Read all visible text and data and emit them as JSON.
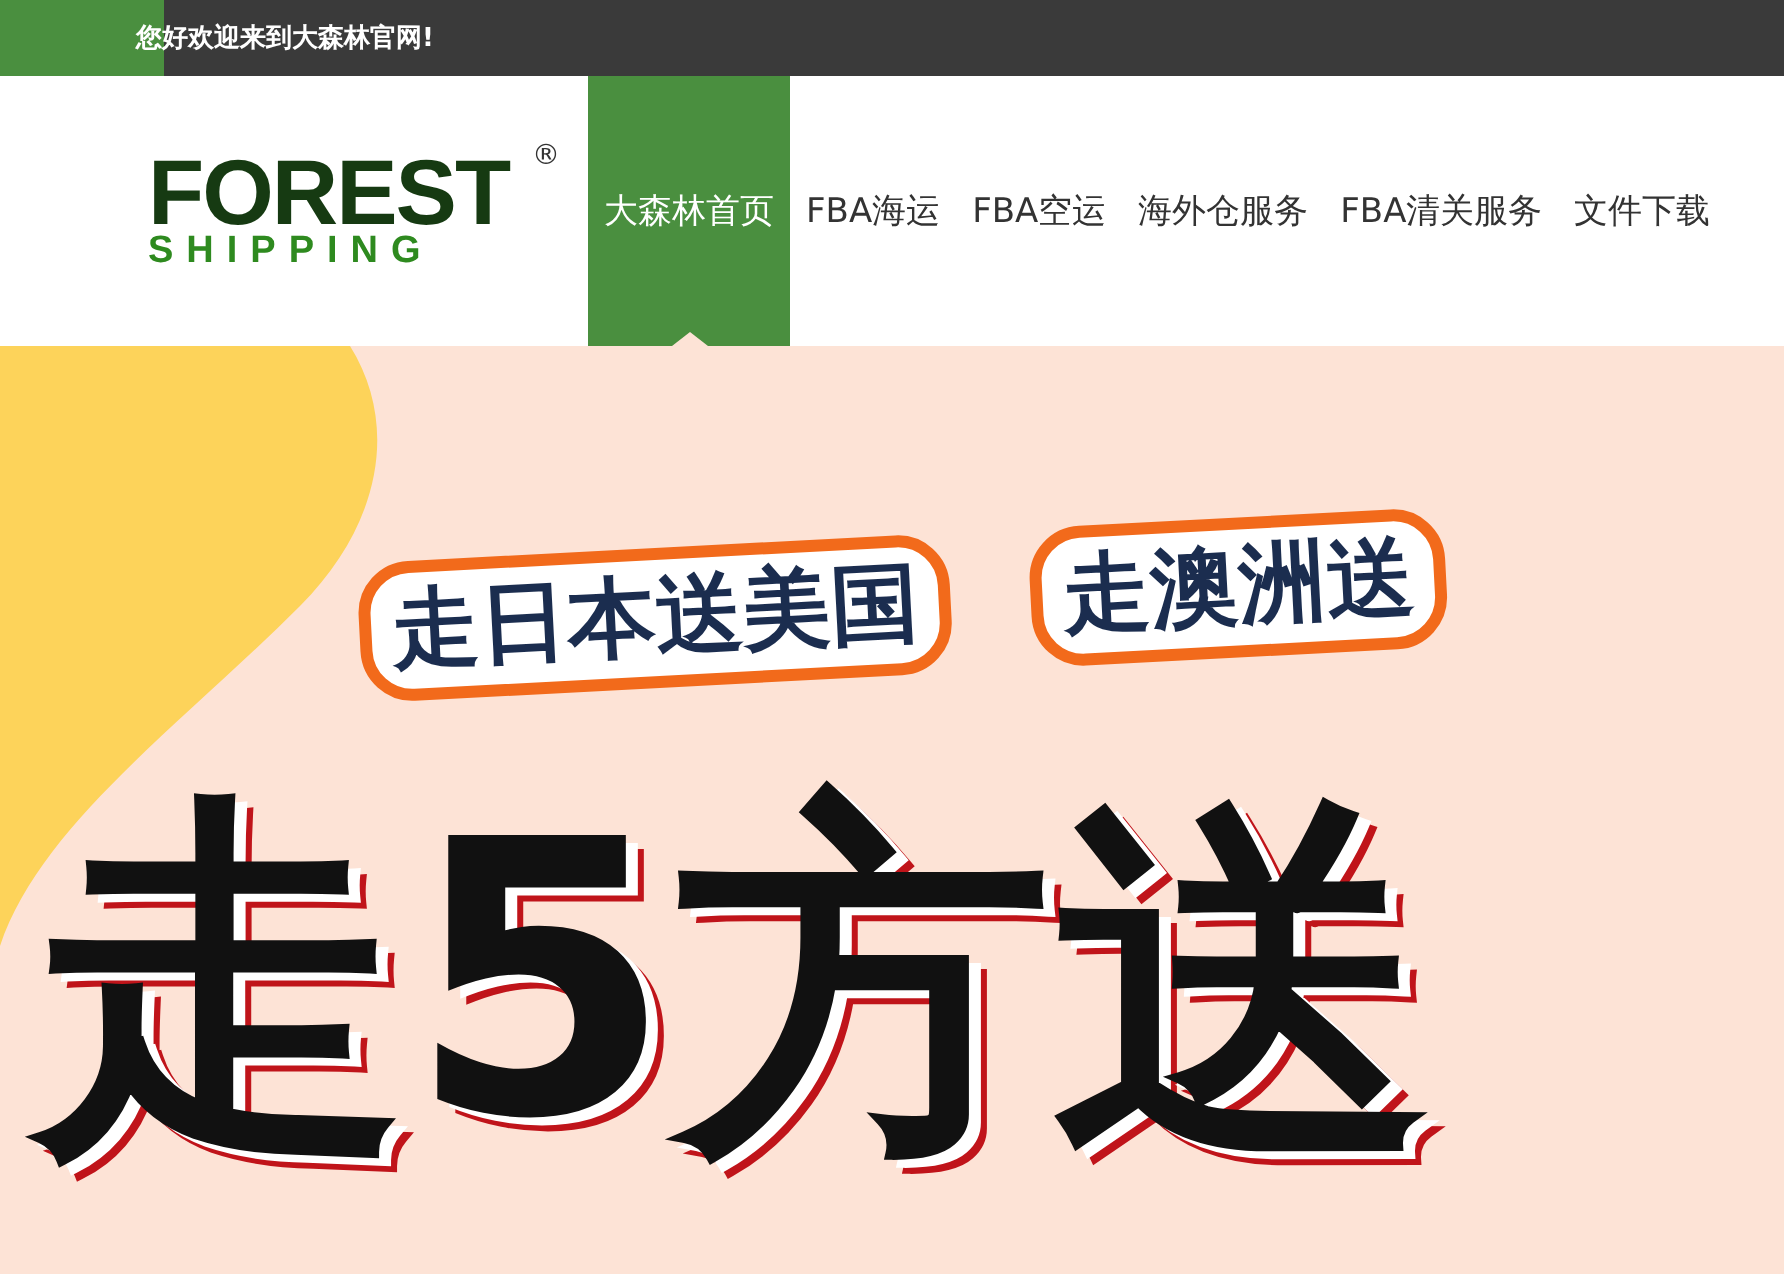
{
  "top_bar": {
    "welcome": "您好欢迎来到大森林官网!"
  },
  "logo": {
    "line_1": "FOREST",
    "line_2": "SHIPPING",
    "mark": "®"
  },
  "nav": [
    {
      "label": "大森林首页",
      "selected": true
    },
    {
      "label": "FBA海运",
      "selected": false
    },
    {
      "label": "FBA空运",
      "selected": false
    },
    {
      "label": "海外仓服务",
      "selected": false
    },
    {
      "label": "FBA清关服务",
      "selected": false
    },
    {
      "label": "文件下载",
      "selected": false
    }
  ],
  "banner": {
    "tags": [
      "走日本送美国",
      "走澳洲送"
    ],
    "headline": "走5方送"
  }
}
